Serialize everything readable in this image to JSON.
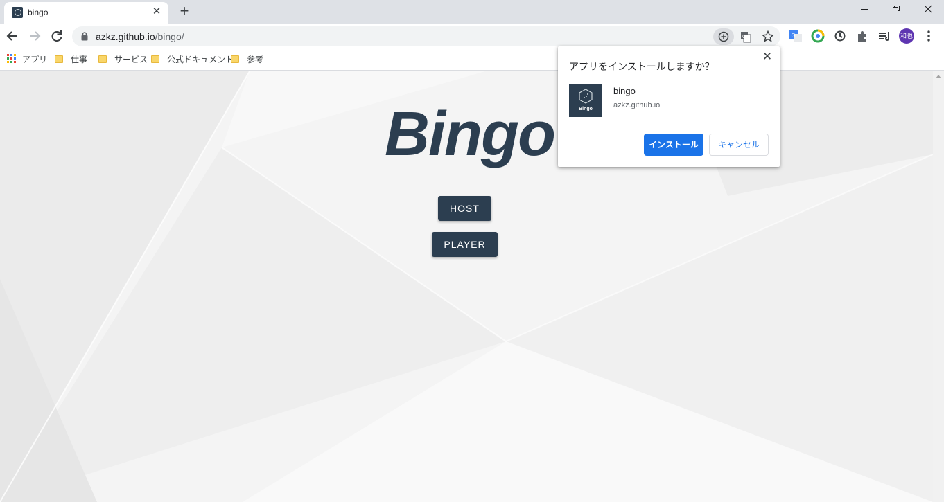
{
  "browser": {
    "tab_title": "bingo",
    "new_tab_label": "+",
    "url_host": "azkz.github.io",
    "url_path": "/bingo/",
    "avatar_text": "和也",
    "bookmarks": [
      "アプリ",
      "仕事",
      "サービス",
      "公式ドキュメント",
      "参考"
    ]
  },
  "page": {
    "title": "Bingo",
    "host_button": "HOST",
    "player_button": "PLAYER"
  },
  "install_dialog": {
    "title": "アプリをインストールしますか？",
    "app_icon_label": "Bingo",
    "app_name": "bingo",
    "app_origin": "azkz.github.io",
    "install_label": "インストール",
    "cancel_label": "キャンセル"
  },
  "colors": {
    "primary": "#2c3e50",
    "accent": "#1a73e8",
    "chrome_frame": "#dee1e6"
  },
  "icons": [
    "bingo-favicon",
    "tab-close-icon",
    "new-tab-icon",
    "minimize-icon",
    "restore-icon",
    "close-window-icon",
    "back-icon",
    "forward-icon",
    "reload-icon",
    "lock-icon",
    "install-app-icon",
    "translate-icon",
    "star-icon",
    "google-translate-ext-icon",
    "speed-ext-icon",
    "sync-ext-icon",
    "extensions-icon",
    "reading-list-icon",
    "menu-icon",
    "apps-grid-icon",
    "folder-icon"
  ]
}
